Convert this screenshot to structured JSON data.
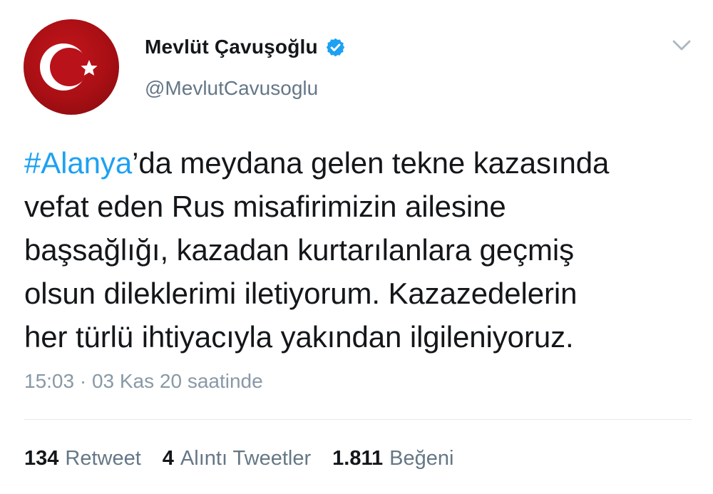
{
  "header": {
    "display_name": "Mevlüt Çavuşoğlu",
    "handle": "@MevlutCavusoglu",
    "verified": true,
    "avatar_icon": "turkish-flag-icon",
    "menu_icon": "chevron-down-icon"
  },
  "tweet": {
    "lines": [
      {
        "hashtag": "#Alanya",
        "text": "’da meydana gelen tekne kazasında"
      },
      {
        "text": "vefat eden Rus misafirimizin ailesine"
      },
      {
        "text": "başsağlığı, kazadan kurtarılanlara geçmiş"
      },
      {
        "text": "olsun dileklerimi iletiyorum. Kazazedelerin"
      },
      {
        "text": "her türlü ihtiyacıyla yakından ilgileniyoruz."
      }
    ],
    "timestamp": "15:03 · 03 Kas 20 saatinde"
  },
  "stats": {
    "retweets": {
      "count": "134",
      "label": "Retweet"
    },
    "quotes": {
      "count": "4",
      "label": "Alıntı Tweetler"
    },
    "likes": {
      "count": "1.811",
      "label": "Beğeni"
    }
  },
  "colors": {
    "accent": "#1da1f2",
    "text": "#14171a",
    "secondary": "#657786",
    "flag_red": "#c4161c"
  }
}
